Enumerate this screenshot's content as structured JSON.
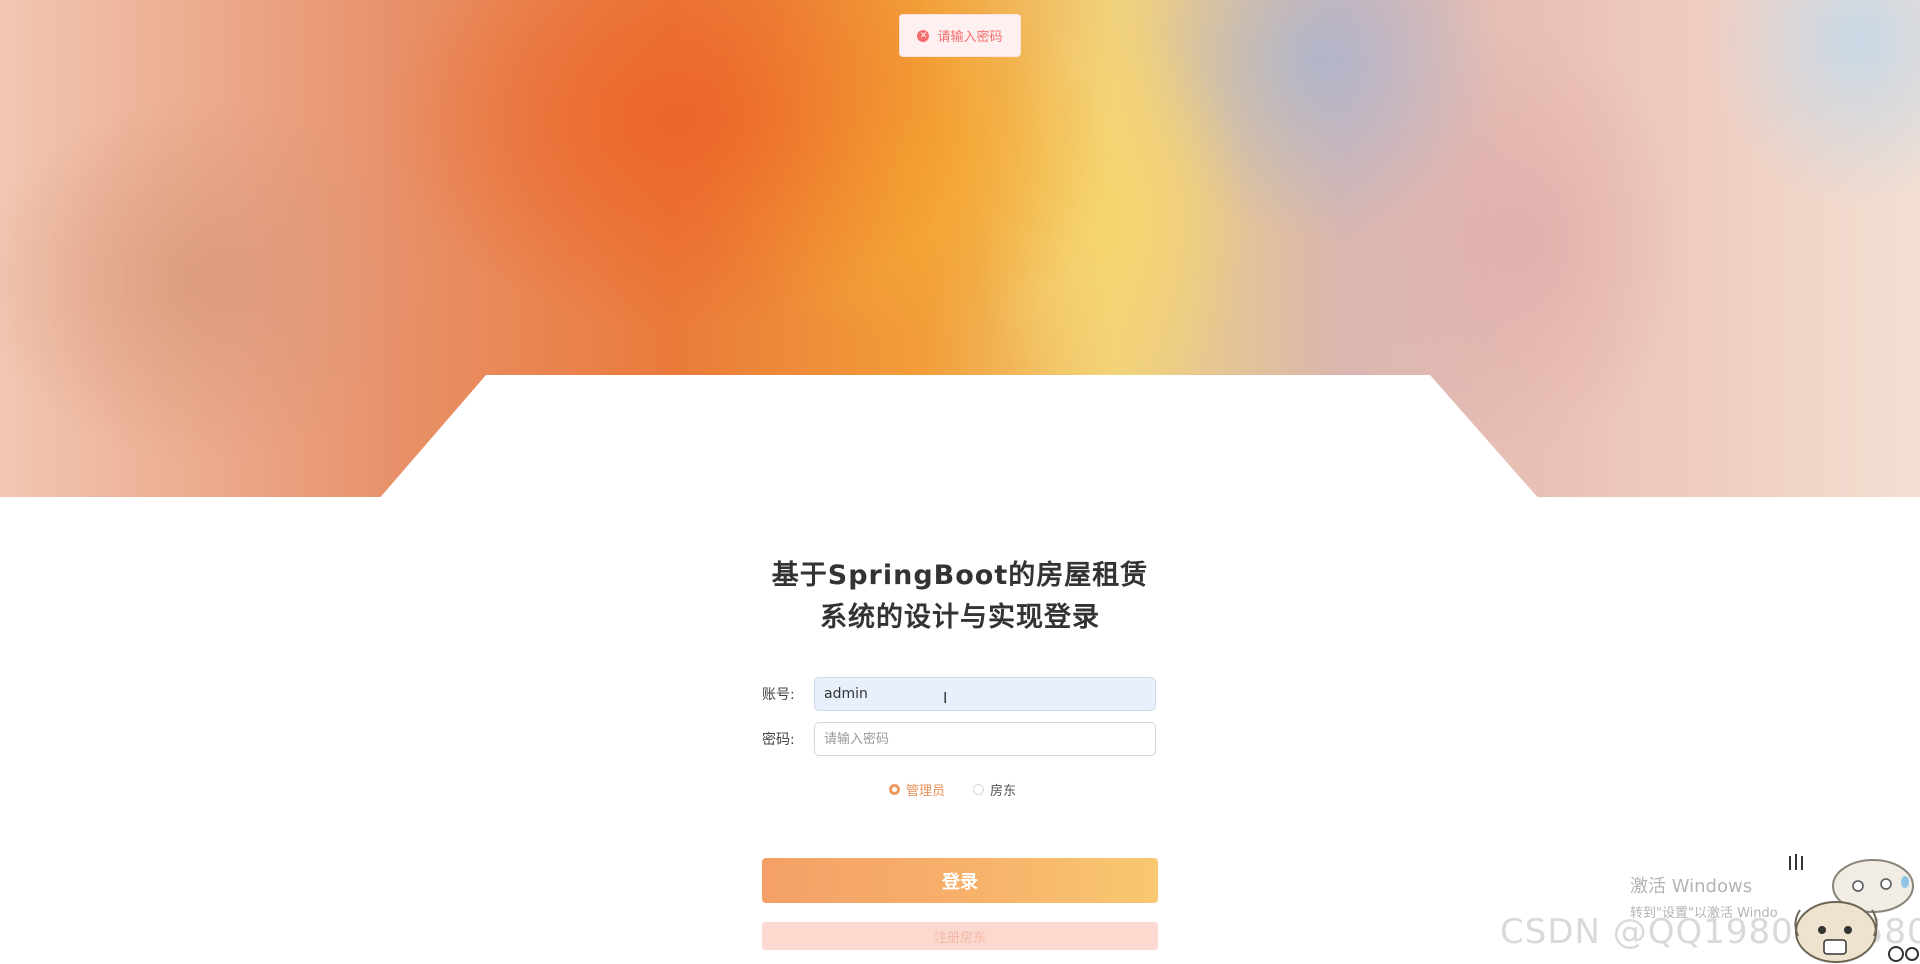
{
  "toast": {
    "icon": "error-circle-icon",
    "message": "请输入密码",
    "color": "#f56c6c"
  },
  "login": {
    "title": "基于SpringBoot的房屋租赁系统的设计与实现登录",
    "account_label": "账号:",
    "account_value": "admin",
    "password_label": "密码:",
    "password_value": "",
    "password_placeholder": "请输入密码",
    "roles": [
      {
        "label": "管理员",
        "selected": true
      },
      {
        "label": "房东",
        "selected": false
      }
    ],
    "login_button": "登录",
    "register_button": "注册房东",
    "accent_color": "#f4a068"
  },
  "overlay": {
    "windows_activation_title": "激活 Windows",
    "windows_activation_hint": "转到\"设置\"以激活 Windo",
    "watermark": "CSDN @QQ1980691580",
    "mascot_icon": "dog-mascot-icon"
  }
}
